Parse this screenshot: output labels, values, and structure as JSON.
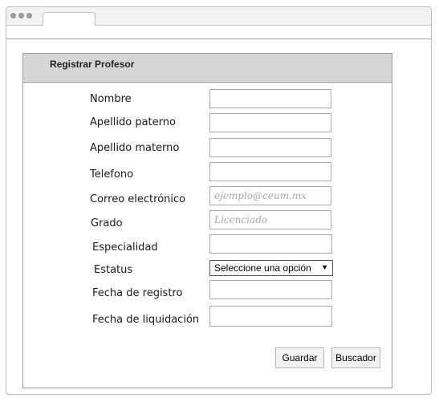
{
  "form": {
    "title": "Registrar Profesor",
    "labels": {
      "nombre": "Nombre",
      "apellido_paterno": "Apellido paterno",
      "apellido_materno": "Apellido materno",
      "telefono": "Telefono",
      "correo": "Correo electrónico",
      "grado": "Grado",
      "especialidad": "Especialidad",
      "estatus": "Estatus",
      "fecha_registro": "Fecha de registro",
      "fecha_liquidacion": "Fecha de liquidación"
    },
    "placeholders": {
      "correo": "ejemplo@ceum.mx",
      "grado": "Licenciado"
    },
    "estatus_selected": "Seleccione una opción",
    "buttons": {
      "guardar": "Guardar",
      "buscador": "Buscador"
    }
  },
  "icons": {
    "dropdown": "triangle-down-icon"
  }
}
